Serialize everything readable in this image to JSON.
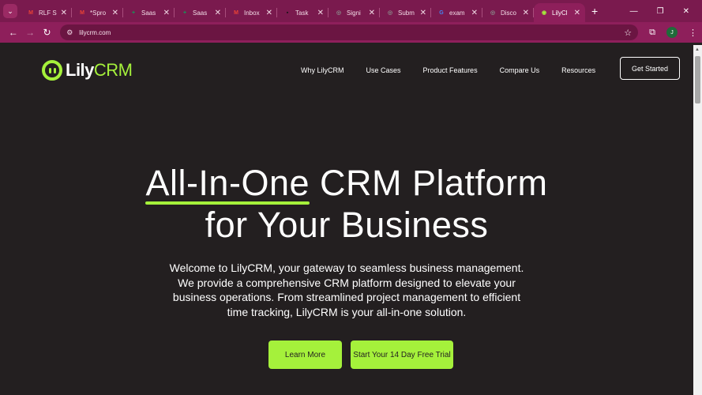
{
  "browser": {
    "tabs": [
      {
        "title": "RLF S",
        "fav": "M",
        "fav_color": "#ea4335"
      },
      {
        "title": "*Spro",
        "fav": "M",
        "fav_color": "#ea4335"
      },
      {
        "title": "Saas",
        "fav": "+",
        "fav_color": "#0f9d58"
      },
      {
        "title": "Saas",
        "fav": "+",
        "fav_color": "#0f9d58"
      },
      {
        "title": "Inbox",
        "fav": "M",
        "fav_color": "#ea4335"
      },
      {
        "title": "Task",
        "fav": "▪",
        "fav_color": "#111111"
      },
      {
        "title": "Signi",
        "fav": "◎",
        "fav_color": "#8a8a8a"
      },
      {
        "title": "Subm",
        "fav": "◎",
        "fav_color": "#8a8a8a"
      },
      {
        "title": "exam",
        "fav": "G",
        "fav_color": "#4285f4"
      },
      {
        "title": "Disco",
        "fav": "◎",
        "fav_color": "#8a8a8a"
      },
      {
        "title": "LilyCl",
        "fav": "◉",
        "fav_color": "#a5f13b",
        "active": true
      }
    ],
    "url": "lilycrm.com",
    "avatar_initial": "J"
  },
  "site": {
    "logo_lily": "Lily",
    "logo_crm": "CRM",
    "nav": [
      "Why LilyCRM",
      "Use Cases",
      "Product Features",
      "Compare Us",
      "Resources"
    ],
    "get_started": "Get Started"
  },
  "hero": {
    "title_highlight": "All-In-One",
    "title_rest_line1": " CRM Platform",
    "title_line2": "for Your Business",
    "description_lines": [
      "Welcome to LilyCRM, your gateway to seamless business management.",
      "We provide a comprehensive CRM platform designed to elevate your",
      "business operations. From streamlined project management to efficient",
      "time tracking, LilyCRM is your all-in-one solution."
    ],
    "learn_more": "Learn More",
    "free_trial": "Start Your 14 Day Free Trial"
  },
  "colors": {
    "accent": "#a5f13b",
    "background": "#231f20",
    "browser_frame": "#8e1f5b"
  }
}
